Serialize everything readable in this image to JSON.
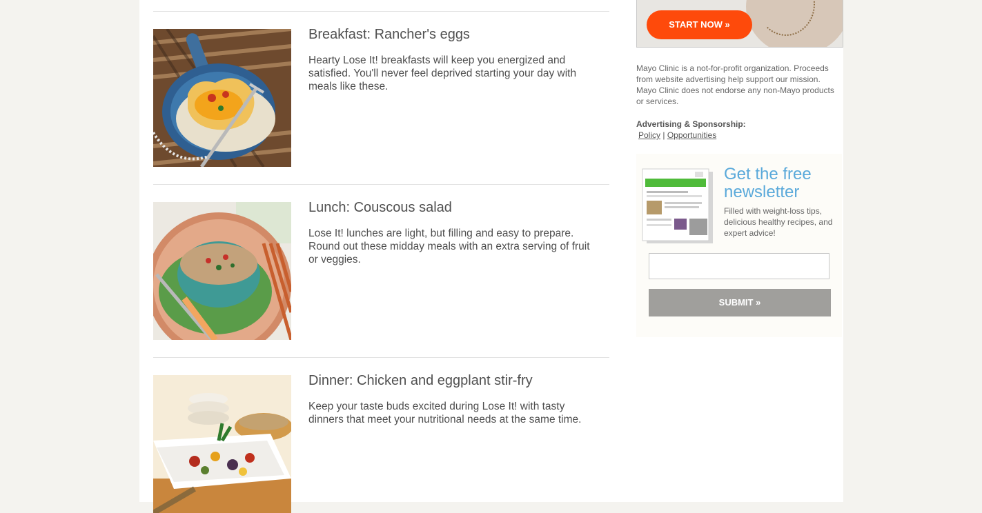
{
  "articles": [
    {
      "title": "Breakfast: Rancher's eggs",
      "description": "Hearty Lose It! breakfasts will keep you energized and satisfied. You'll never feel deprived starting your day with meals like these."
    },
    {
      "title": "Lunch: Couscous salad",
      "description": "Lose It! lunches are light, but filling and easy to prepare. Round out these midday meals with an extra serving of fruit or veggies."
    },
    {
      "title": "Dinner: Chicken and eggplant stir-fry",
      "description": "Keep your taste buds excited during Lose It! with tasty dinners that meet your nutritional needs at the same time."
    }
  ],
  "sidebar": {
    "ad": {
      "button_label": "START NOW »"
    },
    "disclaimer": "Mayo Clinic is a not-for-profit organization. Proceeds from website advertising help support our mission. Mayo Clinic does not endorse any non-Mayo products or services.",
    "sponsorship": {
      "heading": "Advertising & Sponsorship:",
      "policy_link": "Policy",
      "separator": "|",
      "opportunities_link": "Opportunities"
    },
    "newsletter": {
      "title": "Get the free newsletter",
      "subtitle": "Filled with weight-loss tips, delicious healthy recipes, and expert advice!",
      "email_value": "",
      "submit_label": "SUBMIT »"
    }
  },
  "colors": {
    "page_bg": "#f4f3ef",
    "accent_orange": "#fe4a0b",
    "newsletter_blue": "#5aa9da",
    "submit_gray": "#a09f9c"
  }
}
